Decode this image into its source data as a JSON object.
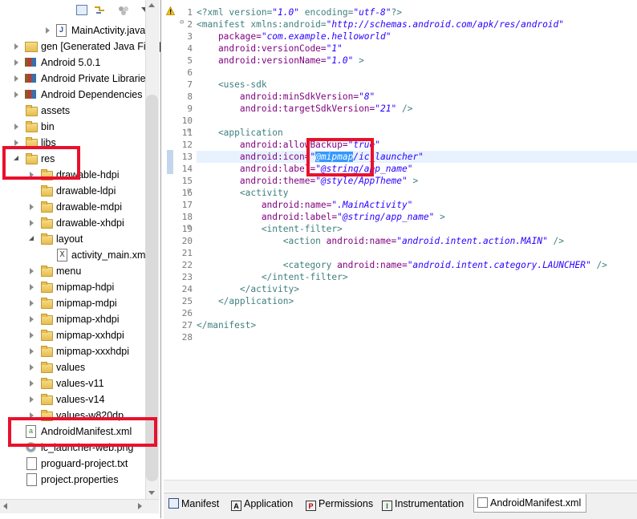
{
  "explorer": {
    "items": [
      {
        "label": "MainActivity.java",
        "icon": "java-file-icon"
      },
      {
        "label": "gen [Generated Java Files]",
        "icon": "package-folder-icon"
      },
      {
        "label": "Android 5.0.1",
        "icon": "library-icon"
      },
      {
        "label": "Android Private Libraries",
        "icon": "library-icon"
      },
      {
        "label": "Android Dependencies",
        "icon": "library-icon"
      },
      {
        "label": "assets",
        "icon": "folder-icon"
      },
      {
        "label": "bin",
        "icon": "folder-icon"
      },
      {
        "label": "libs",
        "icon": "folder-icon"
      },
      {
        "label": "res",
        "icon": "folder-icon"
      },
      {
        "label": "drawable-hdpi",
        "icon": "folder-icon"
      },
      {
        "label": "drawable-ldpi",
        "icon": "folder-icon"
      },
      {
        "label": "drawable-mdpi",
        "icon": "folder-icon"
      },
      {
        "label": "drawable-xhdpi",
        "icon": "folder-icon"
      },
      {
        "label": "layout",
        "icon": "folder-icon"
      },
      {
        "label": "activity_main.xml",
        "icon": "xml-file-icon"
      },
      {
        "label": "menu",
        "icon": "folder-icon"
      },
      {
        "label": "mipmap-hdpi",
        "icon": "folder-icon"
      },
      {
        "label": "mipmap-mdpi",
        "icon": "folder-icon"
      },
      {
        "label": "mipmap-xhdpi",
        "icon": "folder-icon"
      },
      {
        "label": "mipmap-xxhdpi",
        "icon": "folder-icon"
      },
      {
        "label": "mipmap-xxxhdpi",
        "icon": "folder-icon"
      },
      {
        "label": "values",
        "icon": "folder-icon"
      },
      {
        "label": "values-v11",
        "icon": "folder-icon"
      },
      {
        "label": "values-v14",
        "icon": "folder-icon"
      },
      {
        "label": "values-w820dp",
        "icon": "folder-icon"
      },
      {
        "label": "AndroidManifest.xml",
        "icon": "manifest-file-icon"
      },
      {
        "label": "ic_launcher-web.png",
        "icon": "image-file-icon"
      },
      {
        "label": "proguard-project.txt",
        "icon": "text-file-icon"
      },
      {
        "label": "project.properties",
        "icon": "text-file-icon"
      }
    ]
  },
  "editor": {
    "line_numbers": [
      "1",
      "2",
      "3",
      "4",
      "5",
      "6",
      "7",
      "8",
      "9",
      "10",
      "11",
      "12",
      "13",
      "14",
      "15",
      "16",
      "17",
      "18",
      "19",
      "20",
      "21",
      "22",
      "23",
      "24",
      "25",
      "26",
      "27",
      "28"
    ],
    "lines": {
      "l1": [
        "<?xml version=",
        "\"1.0\"",
        " encoding=",
        "\"utf-8\"",
        "?>"
      ],
      "l2": [
        "<manifest xmlns:android=",
        "\"http://schemas.android.com/apk/res/android\""
      ],
      "l3": [
        "    package=",
        "\"com.example.helloworld\""
      ],
      "l4": [
        "    android:versionCode=",
        "\"1\""
      ],
      "l5": [
        "    android:versionName=",
        "\"1.0\"",
        " >"
      ],
      "l7": [
        "    <uses-sdk"
      ],
      "l8": [
        "        android:minSdkVersion=",
        "\"8\""
      ],
      "l9": [
        "        android:targetSdkVersion=",
        "\"21\"",
        " />"
      ],
      "l11": [
        "    <application"
      ],
      "l12": [
        "        android:allowBackup=",
        "\"true\""
      ],
      "l13": [
        "        android:icon=",
        "\"",
        "@mipmap",
        "/ic_launcher\""
      ],
      "l14": [
        "        android:label=",
        "\"@string/app_name\""
      ],
      "l15": [
        "        android:theme=",
        "\"@style/AppTheme\"",
        " >"
      ],
      "l16": [
        "        <activity"
      ],
      "l17": [
        "            android:name=",
        "\".MainActivity\""
      ],
      "l18": [
        "            android:label=",
        "\"@string/app_name\"",
        " >"
      ],
      "l19": [
        "            <intent-filter>"
      ],
      "l20": [
        "                <action ",
        "android:name=",
        "\"android.intent.action.MAIN\"",
        " />"
      ],
      "l22": [
        "                <category ",
        "android:name=",
        "\"android.intent.category.LAUNCHER\"",
        " />"
      ],
      "l23": [
        "            </intent-filter>"
      ],
      "l24": [
        "        </activity>"
      ],
      "l25": [
        "    </application>"
      ],
      "l27": [
        "</manifest>"
      ]
    }
  },
  "tabs": [
    {
      "label": "Manifest",
      "icon": "manifest-tab-icon"
    },
    {
      "label": "Application",
      "icon": "A"
    },
    {
      "label": "Permissions",
      "icon": "P"
    },
    {
      "label": "Instrumentation",
      "icon": "I"
    },
    {
      "label": "AndroidManifest.xml",
      "icon": "xml-tab-icon"
    }
  ],
  "colors": {
    "highlight_red": "#e8112d",
    "xml_tag": "#3f7f7f",
    "xml_attr": "#7f007f",
    "xml_value": "#2a00ff",
    "selection": "#3399ff"
  }
}
